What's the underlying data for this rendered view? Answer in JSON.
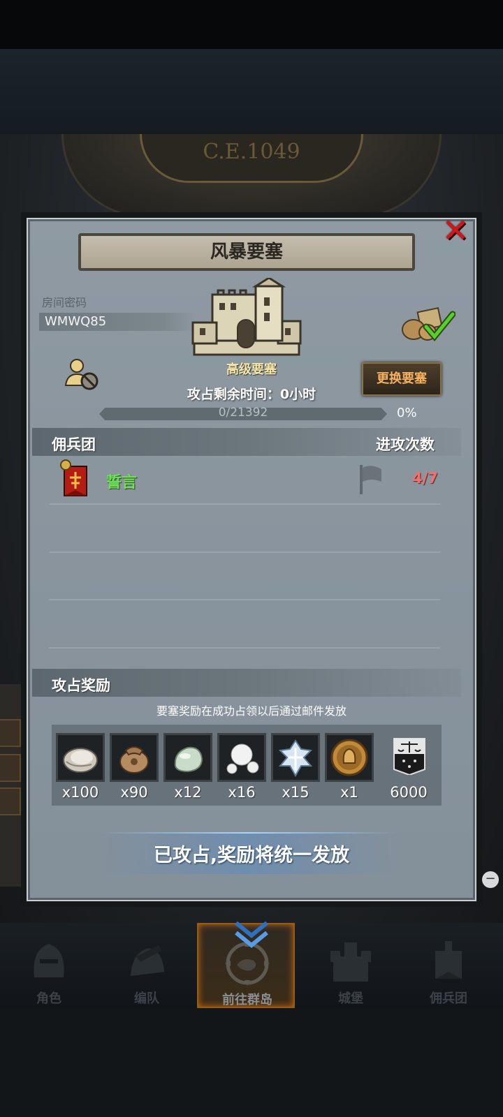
{
  "era_label": "C.E.1049",
  "dialog": {
    "title": "风暴要塞",
    "room_code_label": "房间密码",
    "room_code": "WMWQ85",
    "fortress_level": "高级要塞",
    "time_left": "攻占剩余时间：0小时",
    "change_button": "更换要塞",
    "progress": {
      "text": "0/21392",
      "percent_label": "0%",
      "fraction": 0.0
    },
    "mercenary_section": {
      "title": "佣兵团",
      "attacks_header": "进攻次数"
    },
    "guilds": [
      {
        "name": "誓言",
        "attacks": "4/7"
      }
    ],
    "reward_section": {
      "title": "攻占奖励",
      "note": "要塞奖励在成功占领以后通过邮件发放"
    },
    "rewards": [
      {
        "icon": "oyster-icon",
        "qty": "x100"
      },
      {
        "icon": "sack-icon",
        "qty": "x90"
      },
      {
        "icon": "jade-stone-icon",
        "qty": "x12"
      },
      {
        "icon": "pearls-icon",
        "qty": "x16"
      },
      {
        "icon": "crystal-cross-icon",
        "qty": "x15"
      },
      {
        "icon": "knight-medal-icon",
        "qty": "x1"
      },
      {
        "icon": "justice-banner-icon",
        "qty": "6000"
      }
    ],
    "claim_text": "已攻占,奖励将统一发放"
  },
  "bottom_nav": [
    {
      "label": "角色",
      "icon": "knight-helmet-icon",
      "active": false
    },
    {
      "label": "编队",
      "icon": "formation-icon",
      "active": false
    },
    {
      "label": "前往群岛",
      "icon": "island-compass-icon",
      "active": true
    },
    {
      "label": "城堡",
      "icon": "castle-icon",
      "active": false
    },
    {
      "label": "佣兵团",
      "icon": "mercenary-icon",
      "active": false
    }
  ],
  "colors": {
    "panel": "#8a959e",
    "accent_orange": "#f6b15e",
    "guild_green": "#6fe05a",
    "attack_red": "#ff6b6b",
    "close_red": "#d01717"
  }
}
